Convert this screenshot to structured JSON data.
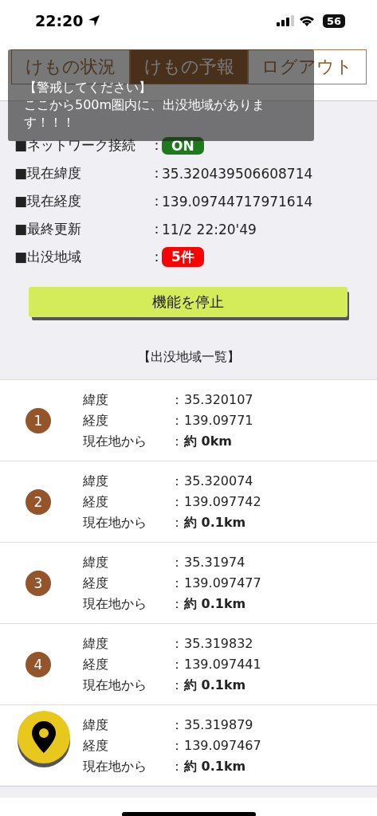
{
  "status_bar": {
    "time": "22:20",
    "battery": "56"
  },
  "tabs": [
    {
      "label": "けもの状況",
      "selected": false
    },
    {
      "label": "けもの予報",
      "selected": true
    },
    {
      "label": "ログアウト",
      "selected": false
    }
  ],
  "info": [
    {
      "label": "■ネットワーク接続",
      "sep": "：",
      "value": "ON",
      "kind": "status"
    },
    {
      "label": "■現在緯度",
      "sep": "：",
      "value": "35.320439506608714",
      "kind": "text"
    },
    {
      "label": "■現在経度",
      "sep": "：",
      "value": "139.09744717971614",
      "kind": "text"
    },
    {
      "label": "■最終更新",
      "sep": "：",
      "value": "11/2 22:20'49",
      "kind": "text"
    },
    {
      "label": "■出没地域",
      "sep": "：",
      "value": "5件",
      "kind": "count"
    }
  ],
  "stop_button": "機能を停止",
  "list_title": "【出没地域一覧】",
  "areas": [
    {
      "number": "1",
      "rows": [
        {
          "label": "緯度",
          "sep": "：",
          "value": "35.320107"
        },
        {
          "label": "経度",
          "sep": "：",
          "value": "139.09771"
        },
        {
          "label": "現在地から",
          "sep": "：",
          "value": "約 0km"
        }
      ]
    },
    {
      "number": "2",
      "rows": [
        {
          "label": "緯度",
          "sep": "：",
          "value": "35.320074"
        },
        {
          "label": "経度",
          "sep": "：",
          "value": "139.097742"
        },
        {
          "label": "現在地から",
          "sep": "：",
          "value": "約 0.1km"
        }
      ]
    },
    {
      "number": "3",
      "rows": [
        {
          "label": "緯度",
          "sep": "：",
          "value": "35.31974"
        },
        {
          "label": "経度",
          "sep": "：",
          "value": "139.097477"
        },
        {
          "label": "現在地から",
          "sep": "：",
          "value": "約 0.1km"
        }
      ]
    },
    {
      "number": "4",
      "rows": [
        {
          "label": "緯度",
          "sep": "：",
          "value": "35.319832"
        },
        {
          "label": "経度",
          "sep": "：",
          "value": "139.097441"
        },
        {
          "label": "現在地から",
          "sep": "：",
          "value": "約 0.1km"
        }
      ]
    },
    {
      "rows": [
        {
          "label": "緯度",
          "sep": "：",
          "value": "35.319879"
        },
        {
          "label": "経度",
          "sep": "：",
          "value": "139.097467"
        },
        {
          "label": "現在地から",
          "sep": "：",
          "value": "約 0.1km"
        }
      ]
    }
  ],
  "toast": {
    "title": "【警戒してください】",
    "message": "ここから500m圏内に、出没地域があります！！！"
  }
}
